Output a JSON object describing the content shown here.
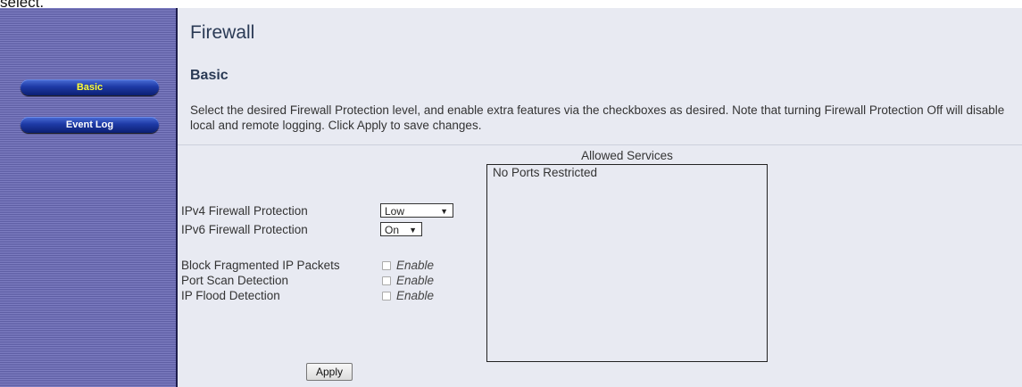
{
  "top_fragment": "select.",
  "sidebar": {
    "items": [
      {
        "label": "Basic"
      },
      {
        "label": "Event Log"
      }
    ]
  },
  "header": {
    "title": "Firewall",
    "subtitle": "Basic",
    "description": "Select the desired Firewall Protection level, and enable extra features via the checkboxes as desired. Note that turning Firewall Protection Off will disable local and remote logging. Click Apply to save changes."
  },
  "settings": {
    "ipv4": {
      "label": "IPv4 Firewall Protection",
      "value": "Low"
    },
    "ipv6": {
      "label": "IPv6 Firewall Protection",
      "value": "On"
    },
    "block_fragmented": {
      "label": "Block Fragmented IP Packets",
      "option": "Enable",
      "checked": false
    },
    "port_scan": {
      "label": "Port Scan Detection",
      "option": "Enable",
      "checked": false
    },
    "ip_flood": {
      "label": "IP Flood Detection",
      "option": "Enable",
      "checked": false
    }
  },
  "allowed_services": {
    "title": "Allowed Services",
    "items": [
      "No Ports Restricted"
    ]
  },
  "actions": {
    "apply_label": "Apply"
  },
  "icons": {
    "dropdown": "chevron-down-icon"
  },
  "colors": {
    "nav_active_text": "#ffff33",
    "nav_button": "#1e3aa6",
    "content_bg": "#e8eaf2"
  }
}
